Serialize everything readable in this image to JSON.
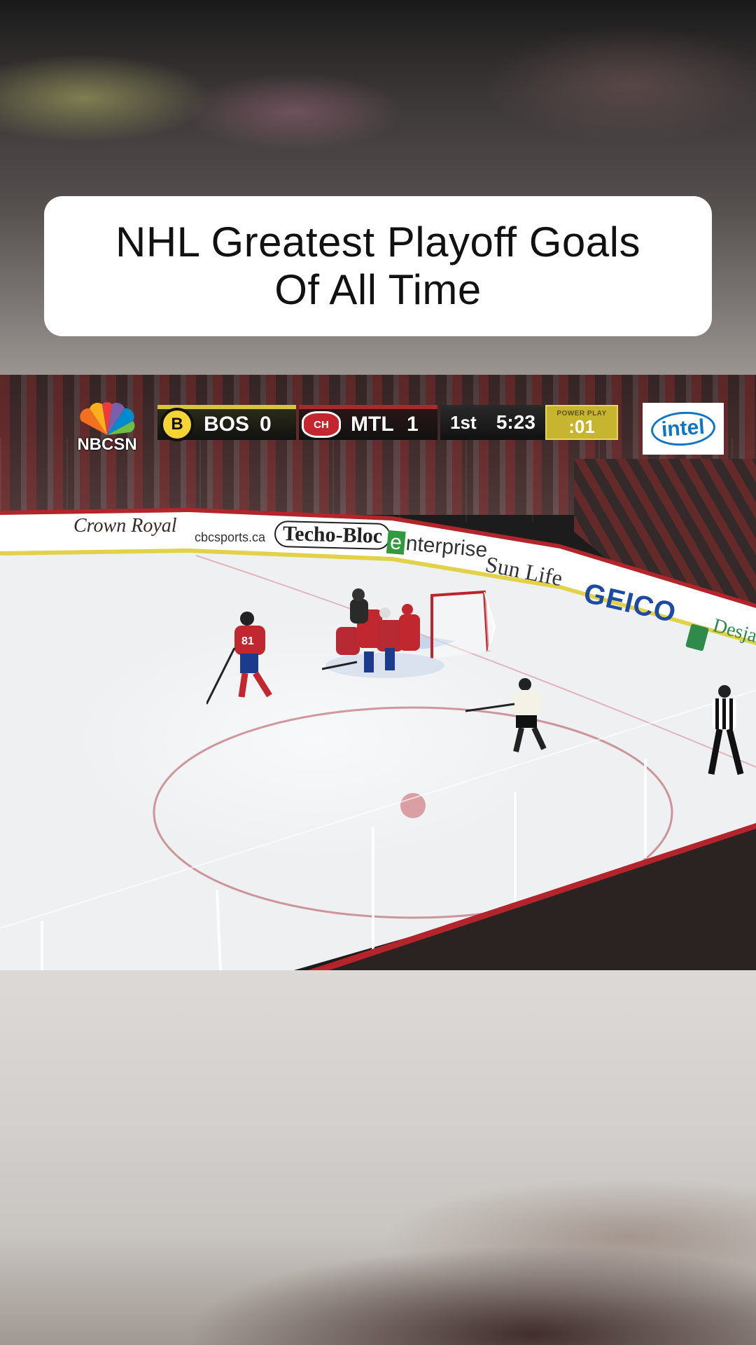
{
  "title": {
    "line1": "NHL Greatest Playoff Goals",
    "line2": "Of All Time"
  },
  "broadcast": {
    "network": "NBCSN",
    "sponsor": "intel"
  },
  "scoreboard": {
    "away": {
      "abbr": "BOS",
      "score": "0",
      "logo": "B",
      "color": "#d6c53b"
    },
    "home": {
      "abbr": "MTL",
      "score": "1",
      "logo": "CH",
      "color": "#a62a2e"
    },
    "period": "1st",
    "clock": "5:23",
    "power_play_label": "POWER PLAY",
    "power_play_time": ":01"
  },
  "board_ads": {
    "ad1": "Crown Royal",
    "ad2": "cbcsports.ca",
    "ad3": "Techo-Bloc",
    "ad4_mark": "e",
    "ad4": "nterprise",
    "ad5": "Sun Life",
    "ad6": "GEICO",
    "ad7": "Desja"
  },
  "colors": {
    "habs_red": "#b4242b",
    "bruins_gold": "#d6c53b",
    "intel_blue": "#1275c3",
    "geico_blue": "#1d4aa3"
  }
}
